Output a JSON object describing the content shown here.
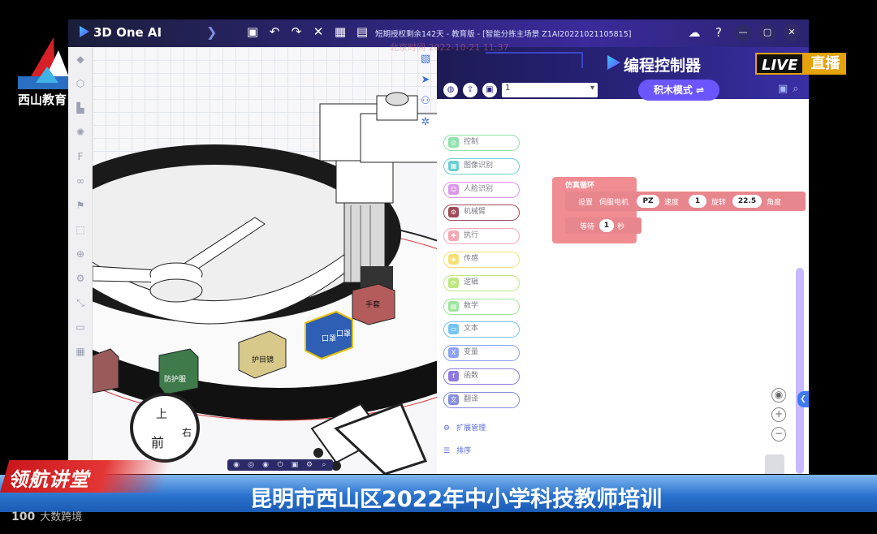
{
  "broadcast": {
    "channel_label": "西山教育",
    "live_label": "LIVE",
    "live_text": "直播",
    "segment_tag": "领航讲堂",
    "headline": "昆明市西山区2022年中小学科技教师培训",
    "footer_brand": "大数跨境",
    "footer_brand_mark": "100",
    "watermark": "北京时间 2022-10-21 11:37"
  },
  "app": {
    "name": "3D One AI",
    "window_title": "短期授权剩余142天 - 教育版 - [智能分拣主场景 Z1AI20221021105815]",
    "toolbar": [
      "save-icon",
      "undo-icon",
      "redo-icon",
      "close-icon",
      "grid-icon",
      "clipboard-icon"
    ],
    "window_controls": [
      "cloud-icon",
      "help-icon",
      "minimize-icon",
      "restore-icon",
      "close-icon"
    ]
  },
  "viewport": {
    "cube_top": "上",
    "cube_front": "前",
    "cube_right": "右",
    "box_labels": [
      "手套",
      "口罩",
      "口罩",
      "护目镜",
      "防护服"
    ]
  },
  "panel": {
    "title": "编程控制器",
    "select_value": "1",
    "mode_button": "积木模式 ⇌",
    "categories": [
      {
        "label": "控制",
        "color": "#7ddc9e",
        "icon": "◎"
      },
      {
        "label": "图像识别",
        "color": "#4fc8c6",
        "icon": "▦"
      },
      {
        "label": "人脸识别",
        "color": "#d583e6",
        "icon": "☺"
      },
      {
        "label": "机械臂",
        "color": "#8a2f3a",
        "icon": "⚙"
      },
      {
        "label": "执行",
        "color": "#f39aa6",
        "icon": "✚"
      },
      {
        "label": "传感",
        "color": "#f1dc5d",
        "icon": "◈"
      },
      {
        "label": "逻辑",
        "color": "#b5e36a",
        "icon": "⟳"
      },
      {
        "label": "数学",
        "color": "#8fe08f",
        "icon": "▤"
      },
      {
        "label": "文本",
        "color": "#5fb9f0",
        "icon": "▭"
      },
      {
        "label": "变量",
        "color": "#7a92f2",
        "icon": "X"
      },
      {
        "label": "函数",
        "color": "#7b63d8",
        "icon": "f"
      },
      {
        "label": "翻译",
        "color": "#6f7ad6",
        "icon": "文"
      }
    ],
    "extension_label": "扩展管理",
    "sort_label": "排序",
    "blocks": {
      "loop_label": "仿真循环",
      "servo_set": "设置",
      "servo_name": "伺服电机",
      "servo_port": "PZ",
      "speed_label": "速度",
      "speed_value": "1",
      "rotate_label": "旋转",
      "rotate_value": "22.5",
      "angle_label": "角度",
      "wait_label": "等待",
      "wait_value": "1",
      "seconds_label": "秒"
    }
  }
}
